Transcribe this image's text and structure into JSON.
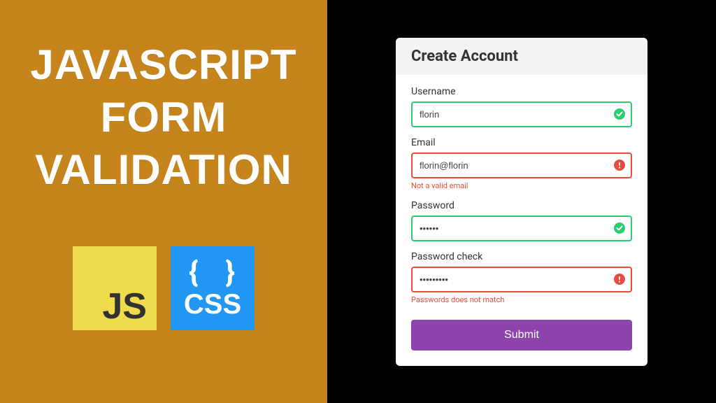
{
  "hero": {
    "line1": "JAVASCRIPT",
    "line2": "FORM",
    "line3": "VALIDATION"
  },
  "badges": {
    "js": "JS",
    "css_braces": "{ }",
    "css": "CSS"
  },
  "form": {
    "title": "Create Account",
    "fields": {
      "username": {
        "label": "Username",
        "value": "florin",
        "status": "success"
      },
      "email": {
        "label": "Email",
        "value": "florin@florin",
        "status": "error",
        "error": "Not a valid email"
      },
      "password": {
        "label": "Password",
        "value": "••••••",
        "status": "success"
      },
      "password_check": {
        "label": "Password check",
        "value": "•••••••••",
        "status": "error",
        "error": "Passwords does not match"
      }
    },
    "submit": "Submit"
  },
  "colors": {
    "hero_bg": "#c5841c",
    "success": "#2ecc71",
    "error": "#e74c3c",
    "submit": "#8e44ad"
  }
}
